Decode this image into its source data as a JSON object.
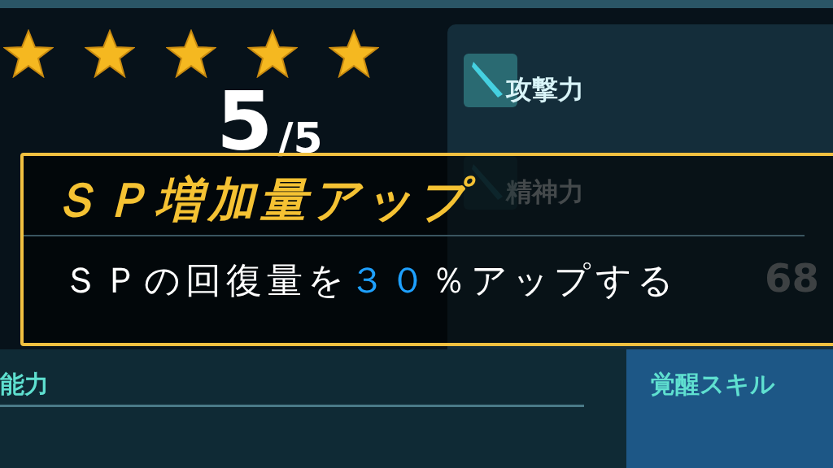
{
  "rating": {
    "stars": 5
  },
  "rank": {
    "current": "5",
    "max": "/5"
  },
  "stats": [
    {
      "label": "攻撃力",
      "dimmed": false
    },
    {
      "label": "精神力",
      "dimmed": true
    }
  ],
  "hidden_value": "68",
  "popup": {
    "title": "ＳＰ増加量アップ",
    "description": [
      {
        "text": "ＳＰの回復量を",
        "highlight": false
      },
      {
        "text": "３０",
        "highlight": true
      },
      {
        "text": "％アップする",
        "highlight": false
      }
    ]
  },
  "sections": [
    {
      "label": "能力"
    },
    {
      "label": "覚醒スキル"
    }
  ]
}
